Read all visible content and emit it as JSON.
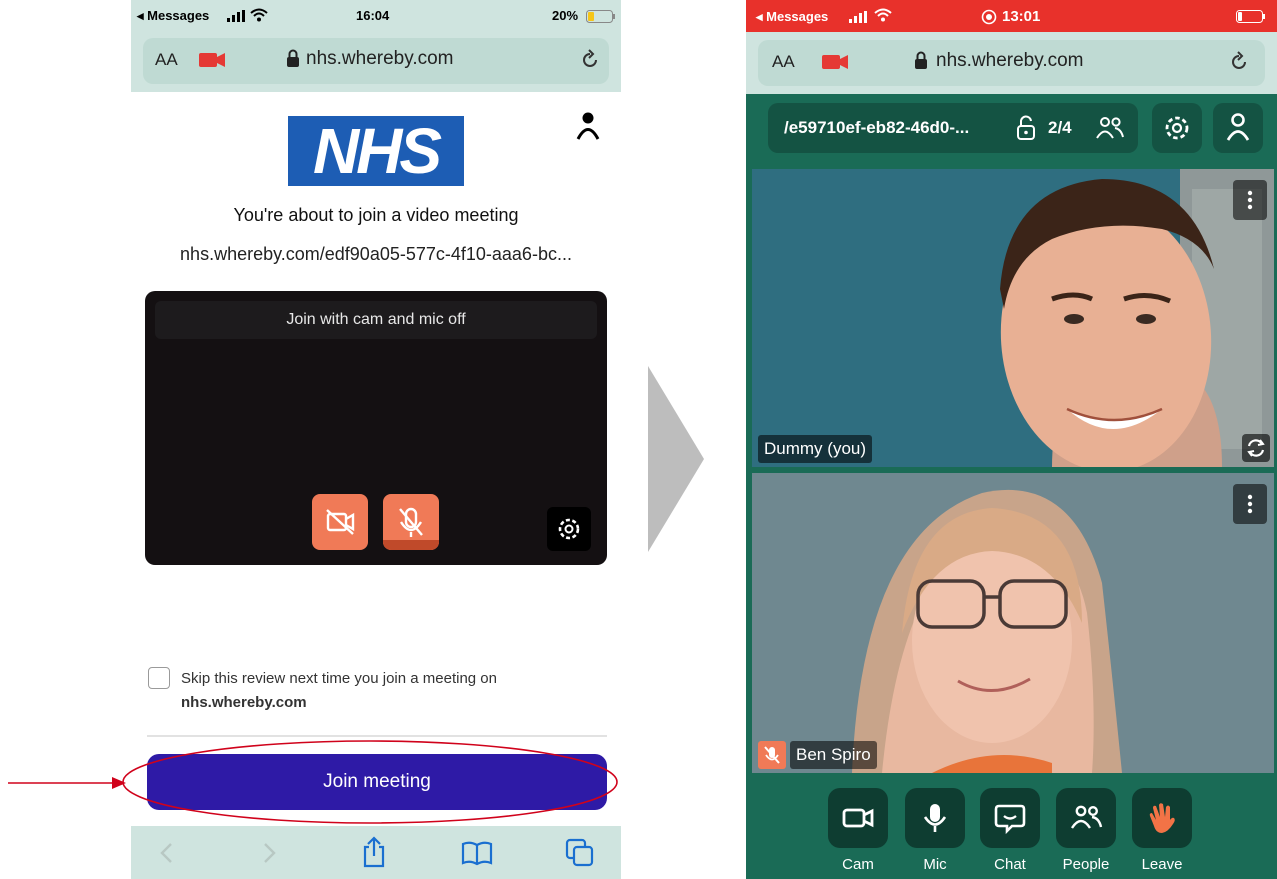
{
  "left": {
    "status": {
      "carrier": "◂ Messages",
      "time": "16:04",
      "battery": "20%"
    },
    "browser": {
      "text_size": "AA",
      "domain": "nhs.whereby.com"
    },
    "logo_text": "NHS",
    "heading": "You're about to join a video meeting",
    "meeting_url": "nhs.whereby.com/edf90a05-577c-4f10-aaa6-bc...",
    "preview_banner": "Join with cam and mic off",
    "skip_label": "Skip this review next time you join a meeting on",
    "skip_domain": "nhs.whereby.com",
    "join_button": "Join meeting"
  },
  "right": {
    "status": {
      "carrier": "◂ Messages",
      "time": "13:01"
    },
    "browser": {
      "text_size": "AA",
      "domain": "nhs.whereby.com"
    },
    "room": {
      "name": "/e59710ef-eb82-46d0-...",
      "count": "2/4"
    },
    "participants": [
      {
        "name": "Dummy (you)"
      },
      {
        "name": "Ben Spiro"
      }
    ],
    "controls": [
      {
        "label": "Cam"
      },
      {
        "label": "Mic"
      },
      {
        "label": "Chat"
      },
      {
        "label": "People"
      },
      {
        "label": "Leave"
      }
    ]
  },
  "colors": {
    "nhs_blue": "#1d5db4",
    "join_purple": "#2e1aa6",
    "preview_orange": "#f07a57",
    "whereby_green": "#1a6b56",
    "status_red": "#e8312b",
    "annotation_red": "#d0021b"
  }
}
